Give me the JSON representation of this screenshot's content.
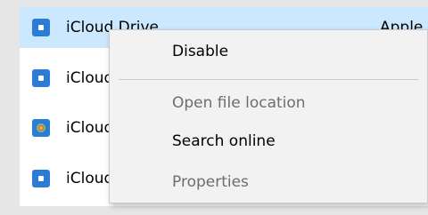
{
  "apps": [
    {
      "name": "iCloud Drive",
      "publisher": "Apple",
      "icon": "icloud-app-icon",
      "selected": true
    },
    {
      "name": "iCloud",
      "publisher": "",
      "icon": "icloud-app-icon",
      "selected": false
    },
    {
      "name": "iCloud",
      "publisher": "",
      "icon": "icloud-photos-icon",
      "selected": false
    },
    {
      "name": "iCloud",
      "publisher": "",
      "icon": "icloud-app-icon",
      "selected": false
    }
  ],
  "context_menu": {
    "items": [
      {
        "label": "Disable",
        "enabled": true
      },
      {
        "label": "Open file location",
        "enabled": false
      },
      {
        "label": "Search online",
        "enabled": true
      },
      {
        "label": "Properties",
        "enabled": false
      }
    ]
  },
  "colors": {
    "selection": "#cce8ff",
    "icon_blue": "#2b7cd3",
    "disabled_text": "#6d6d6d"
  }
}
